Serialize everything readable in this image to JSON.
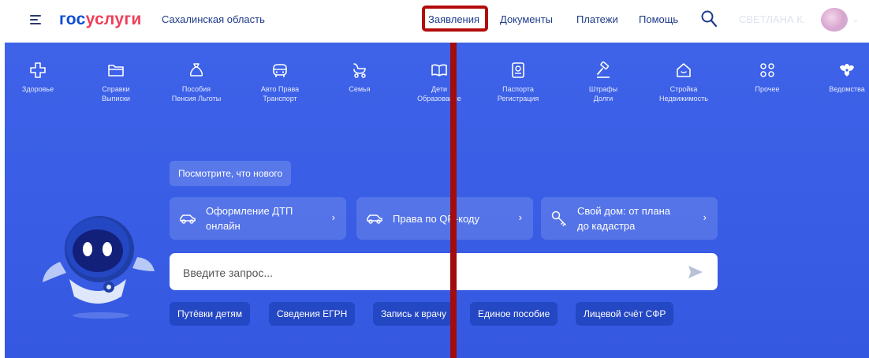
{
  "header": {
    "logo_part1": "гос",
    "logo_part2": "услуги",
    "region": "Сахалинская область",
    "nav": [
      {
        "label": "Заявления"
      },
      {
        "label": "Документы"
      },
      {
        "label": "Платежи"
      },
      {
        "label": "Помощь"
      }
    ],
    "user_name": "СВЕТЛАНА К."
  },
  "categories": [
    {
      "line1": "Здоровье",
      "line2": "",
      "icon": "health-cross-icon"
    },
    {
      "line1": "Справки",
      "line2": "Выписки",
      "icon": "folder-icon"
    },
    {
      "line1": "Пособия",
      "line2": "Пенсия Льготы",
      "icon": "money-bag-icon"
    },
    {
      "line1": "Авто Права",
      "line2": "Транспорт",
      "icon": "car-front-icon"
    },
    {
      "line1": "Семья",
      "line2": "",
      "icon": "stroller-icon"
    },
    {
      "line1": "Дети",
      "line2": "Образование",
      "icon": "book-icon"
    },
    {
      "line1": "Паспорта",
      "line2": "Регистрация",
      "icon": "passport-icon"
    },
    {
      "line1": "Штрафы",
      "line2": "Долги",
      "icon": "gavel-icon"
    },
    {
      "line1": "Стройка",
      "line2": "Недвижимость",
      "icon": "house-icon"
    },
    {
      "line1": "Прочее",
      "line2": "",
      "icon": "grid-icon"
    },
    {
      "line1": "Ведомства",
      "line2": "",
      "icon": "coat-of-arms-icon"
    }
  ],
  "hero": {
    "news_pill": "Посмотрите, что нового",
    "quick_cards": [
      {
        "line1": "Оформление ДТП",
        "line2": "онлайн",
        "icon": "car-icon"
      },
      {
        "line1": "Права по QR-коду",
        "line2": "",
        "icon": "car-icon"
      },
      {
        "line1": "Свой дом: от плана",
        "line2": "до кадастра",
        "icon": "key-icon"
      }
    ],
    "search_placeholder": "Введите запрос...",
    "chips": [
      {
        "label": "Путёвки детям"
      },
      {
        "label": "Сведения ЕГРН"
      },
      {
        "label": "Запись к врачу"
      },
      {
        "label": "Единое пособие"
      },
      {
        "label": "Лицевой счёт СФР"
      }
    ]
  },
  "colors": {
    "brand_blue": "#0d4cd3",
    "brand_red": "#ee3f58",
    "hero_bg": "#3a5fe6",
    "chip_bg": "#2447c4",
    "highlight_annotation": "#b30b0b"
  }
}
